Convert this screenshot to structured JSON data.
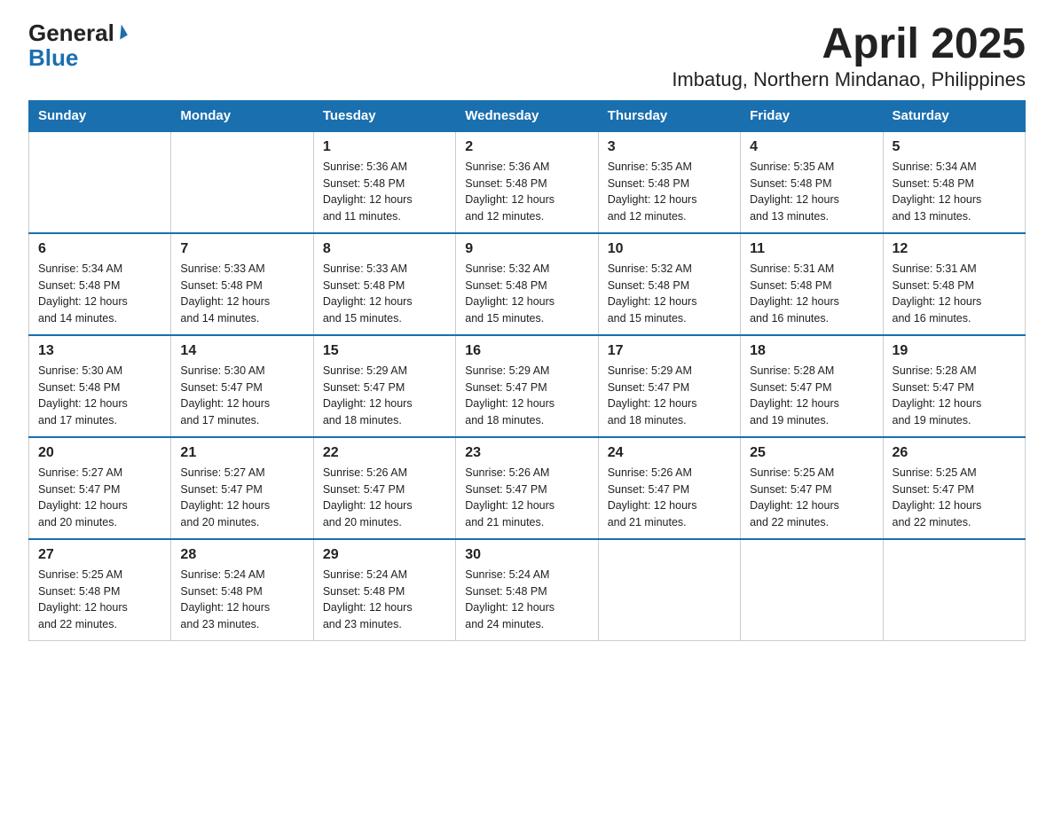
{
  "logo": {
    "general": "General",
    "blue": "Blue"
  },
  "title": "April 2025",
  "subtitle": "Imbatug, Northern Mindanao, Philippines",
  "weekdays": [
    "Sunday",
    "Monday",
    "Tuesday",
    "Wednesday",
    "Thursday",
    "Friday",
    "Saturday"
  ],
  "weeks": [
    [
      {
        "day": "",
        "info": ""
      },
      {
        "day": "",
        "info": ""
      },
      {
        "day": "1",
        "info": "Sunrise: 5:36 AM\nSunset: 5:48 PM\nDaylight: 12 hours\nand 11 minutes."
      },
      {
        "day": "2",
        "info": "Sunrise: 5:36 AM\nSunset: 5:48 PM\nDaylight: 12 hours\nand 12 minutes."
      },
      {
        "day": "3",
        "info": "Sunrise: 5:35 AM\nSunset: 5:48 PM\nDaylight: 12 hours\nand 12 minutes."
      },
      {
        "day": "4",
        "info": "Sunrise: 5:35 AM\nSunset: 5:48 PM\nDaylight: 12 hours\nand 13 minutes."
      },
      {
        "day": "5",
        "info": "Sunrise: 5:34 AM\nSunset: 5:48 PM\nDaylight: 12 hours\nand 13 minutes."
      }
    ],
    [
      {
        "day": "6",
        "info": "Sunrise: 5:34 AM\nSunset: 5:48 PM\nDaylight: 12 hours\nand 14 minutes."
      },
      {
        "day": "7",
        "info": "Sunrise: 5:33 AM\nSunset: 5:48 PM\nDaylight: 12 hours\nand 14 minutes."
      },
      {
        "day": "8",
        "info": "Sunrise: 5:33 AM\nSunset: 5:48 PM\nDaylight: 12 hours\nand 15 minutes."
      },
      {
        "day": "9",
        "info": "Sunrise: 5:32 AM\nSunset: 5:48 PM\nDaylight: 12 hours\nand 15 minutes."
      },
      {
        "day": "10",
        "info": "Sunrise: 5:32 AM\nSunset: 5:48 PM\nDaylight: 12 hours\nand 15 minutes."
      },
      {
        "day": "11",
        "info": "Sunrise: 5:31 AM\nSunset: 5:48 PM\nDaylight: 12 hours\nand 16 minutes."
      },
      {
        "day": "12",
        "info": "Sunrise: 5:31 AM\nSunset: 5:48 PM\nDaylight: 12 hours\nand 16 minutes."
      }
    ],
    [
      {
        "day": "13",
        "info": "Sunrise: 5:30 AM\nSunset: 5:48 PM\nDaylight: 12 hours\nand 17 minutes."
      },
      {
        "day": "14",
        "info": "Sunrise: 5:30 AM\nSunset: 5:47 PM\nDaylight: 12 hours\nand 17 minutes."
      },
      {
        "day": "15",
        "info": "Sunrise: 5:29 AM\nSunset: 5:47 PM\nDaylight: 12 hours\nand 18 minutes."
      },
      {
        "day": "16",
        "info": "Sunrise: 5:29 AM\nSunset: 5:47 PM\nDaylight: 12 hours\nand 18 minutes."
      },
      {
        "day": "17",
        "info": "Sunrise: 5:29 AM\nSunset: 5:47 PM\nDaylight: 12 hours\nand 18 minutes."
      },
      {
        "day": "18",
        "info": "Sunrise: 5:28 AM\nSunset: 5:47 PM\nDaylight: 12 hours\nand 19 minutes."
      },
      {
        "day": "19",
        "info": "Sunrise: 5:28 AM\nSunset: 5:47 PM\nDaylight: 12 hours\nand 19 minutes."
      }
    ],
    [
      {
        "day": "20",
        "info": "Sunrise: 5:27 AM\nSunset: 5:47 PM\nDaylight: 12 hours\nand 20 minutes."
      },
      {
        "day": "21",
        "info": "Sunrise: 5:27 AM\nSunset: 5:47 PM\nDaylight: 12 hours\nand 20 minutes."
      },
      {
        "day": "22",
        "info": "Sunrise: 5:26 AM\nSunset: 5:47 PM\nDaylight: 12 hours\nand 20 minutes."
      },
      {
        "day": "23",
        "info": "Sunrise: 5:26 AM\nSunset: 5:47 PM\nDaylight: 12 hours\nand 21 minutes."
      },
      {
        "day": "24",
        "info": "Sunrise: 5:26 AM\nSunset: 5:47 PM\nDaylight: 12 hours\nand 21 minutes."
      },
      {
        "day": "25",
        "info": "Sunrise: 5:25 AM\nSunset: 5:47 PM\nDaylight: 12 hours\nand 22 minutes."
      },
      {
        "day": "26",
        "info": "Sunrise: 5:25 AM\nSunset: 5:47 PM\nDaylight: 12 hours\nand 22 minutes."
      }
    ],
    [
      {
        "day": "27",
        "info": "Sunrise: 5:25 AM\nSunset: 5:48 PM\nDaylight: 12 hours\nand 22 minutes."
      },
      {
        "day": "28",
        "info": "Sunrise: 5:24 AM\nSunset: 5:48 PM\nDaylight: 12 hours\nand 23 minutes."
      },
      {
        "day": "29",
        "info": "Sunrise: 5:24 AM\nSunset: 5:48 PM\nDaylight: 12 hours\nand 23 minutes."
      },
      {
        "day": "30",
        "info": "Sunrise: 5:24 AM\nSunset: 5:48 PM\nDaylight: 12 hours\nand 24 minutes."
      },
      {
        "day": "",
        "info": ""
      },
      {
        "day": "",
        "info": ""
      },
      {
        "day": "",
        "info": ""
      }
    ]
  ]
}
